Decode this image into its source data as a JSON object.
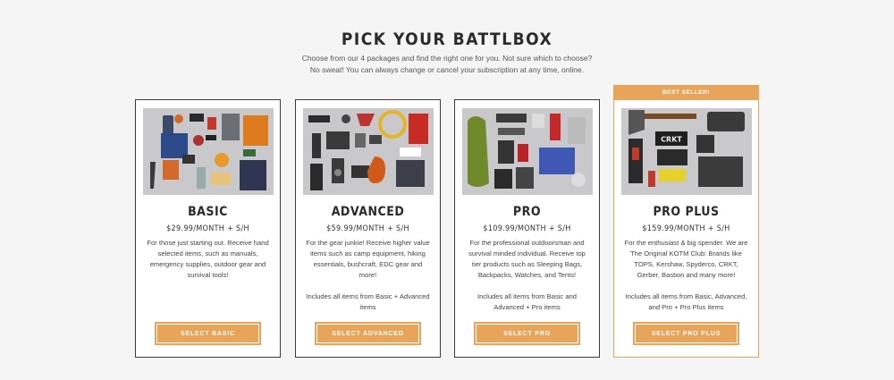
{
  "header": {
    "title": "PICK YOUR BATTLBOX",
    "subtitle_line1": "Choose from our 4 packages and find the right one for you. Not sure which to choose?",
    "subtitle_line2": "No sweat! You can always change or cancel your subscription at any time, online."
  },
  "plans": [
    {
      "name": "BASIC",
      "price": "$29.99/MONTH + S/H",
      "description": "For those just starting out. Receive hand selected items, such as manuals, emergency supplies, outdoor gear and survival tools!",
      "includes": "",
      "button": "SELECT BASIC"
    },
    {
      "name": "ADVANCED",
      "price": "$59.99/MONTH + S/H",
      "description": "For the gear junkie! Receive higher value items such as camp equipment, hiking essentials, bushcraft, EDC gear and more!",
      "includes": "Includes all items from Basic + Advanced items",
      "button": "SELECT ADVANCED"
    },
    {
      "name": "PRO",
      "price": "$109.99/MONTH + S/H",
      "description": "For the professional outdoorsman and survival minded individual. Receive top tier products such as Sleeping Bags, Backpacks, Watches, and Tents!",
      "includes": "Includes all items from Basic and Advanced + Pro items",
      "button": "SELECT PRO"
    },
    {
      "name": "PRO PLUS",
      "badge": "BEST SELLER!",
      "price": "$159.99/MONTH + S/H",
      "description": "For the enthusiast & big spender. We are The Original KOTM Club: Brands like TOPS, Kershaw, Spyderco, CRKT, Gerber, Bastion and many more!",
      "includes": "Includes all items from Basic, Advanced, and Pro + Pro Plus items",
      "button": "SELECT PRO PLUS",
      "image_labels": [
        "CRKT"
      ]
    }
  ],
  "colors": {
    "accent": "#e8a55a",
    "background": "#f5f5f5",
    "card_border": "#3a3a3a"
  }
}
